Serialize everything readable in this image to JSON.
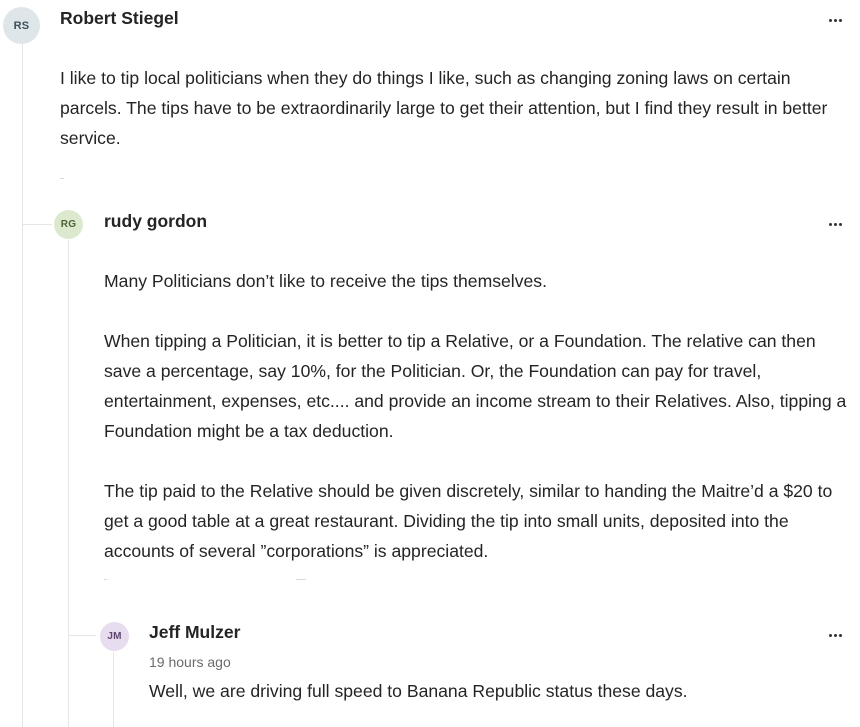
{
  "comments": [
    {
      "initials": "RS",
      "author": "Robert Stiegel",
      "avatar_bg": "#dfe6ea",
      "avatar_fg": "#3d4f5c",
      "paragraphs": [
        "I like to tip local politicians when they do things I like, such as changing zoning laws on certain parcels. The tips have to be extraordinarily large to get their attention, but I find they result in better service."
      ]
    },
    {
      "initials": "RG",
      "author": "rudy gordon",
      "avatar_bg": "#dde9cf",
      "avatar_fg": "#4b6236",
      "paragraphs": [
        "Many Politicians don’t like to receive the tips themselves.",
        "When tipping a Politician, it is better to tip a Relative, or a Foundation. The relative can then save a percentage, say 10%, for the Politician. Or, the Foundation can pay for travel, entertainment, expenses, etc.... and provide an income stream to their Relatives. Also, tipping a Foundation might be a tax deduction.",
        "The tip paid to the Relative should be given discretely, similar to handing the Maitre’d a $20 to get a good table at a great restaurant. Dividing the tip into small units, deposited into the accounts of several ”corporations” is appreciated."
      ]
    },
    {
      "initials": "JM",
      "author": "Jeff Mulzer",
      "timestamp": "19 hours ago",
      "avatar_bg": "#e8dcef",
      "avatar_fg": "#5e4670",
      "paragraphs": [
        "Well, we are driving full speed to Banana Republic status these days."
      ]
    }
  ],
  "icons": {
    "more": "more-options-icon"
  }
}
